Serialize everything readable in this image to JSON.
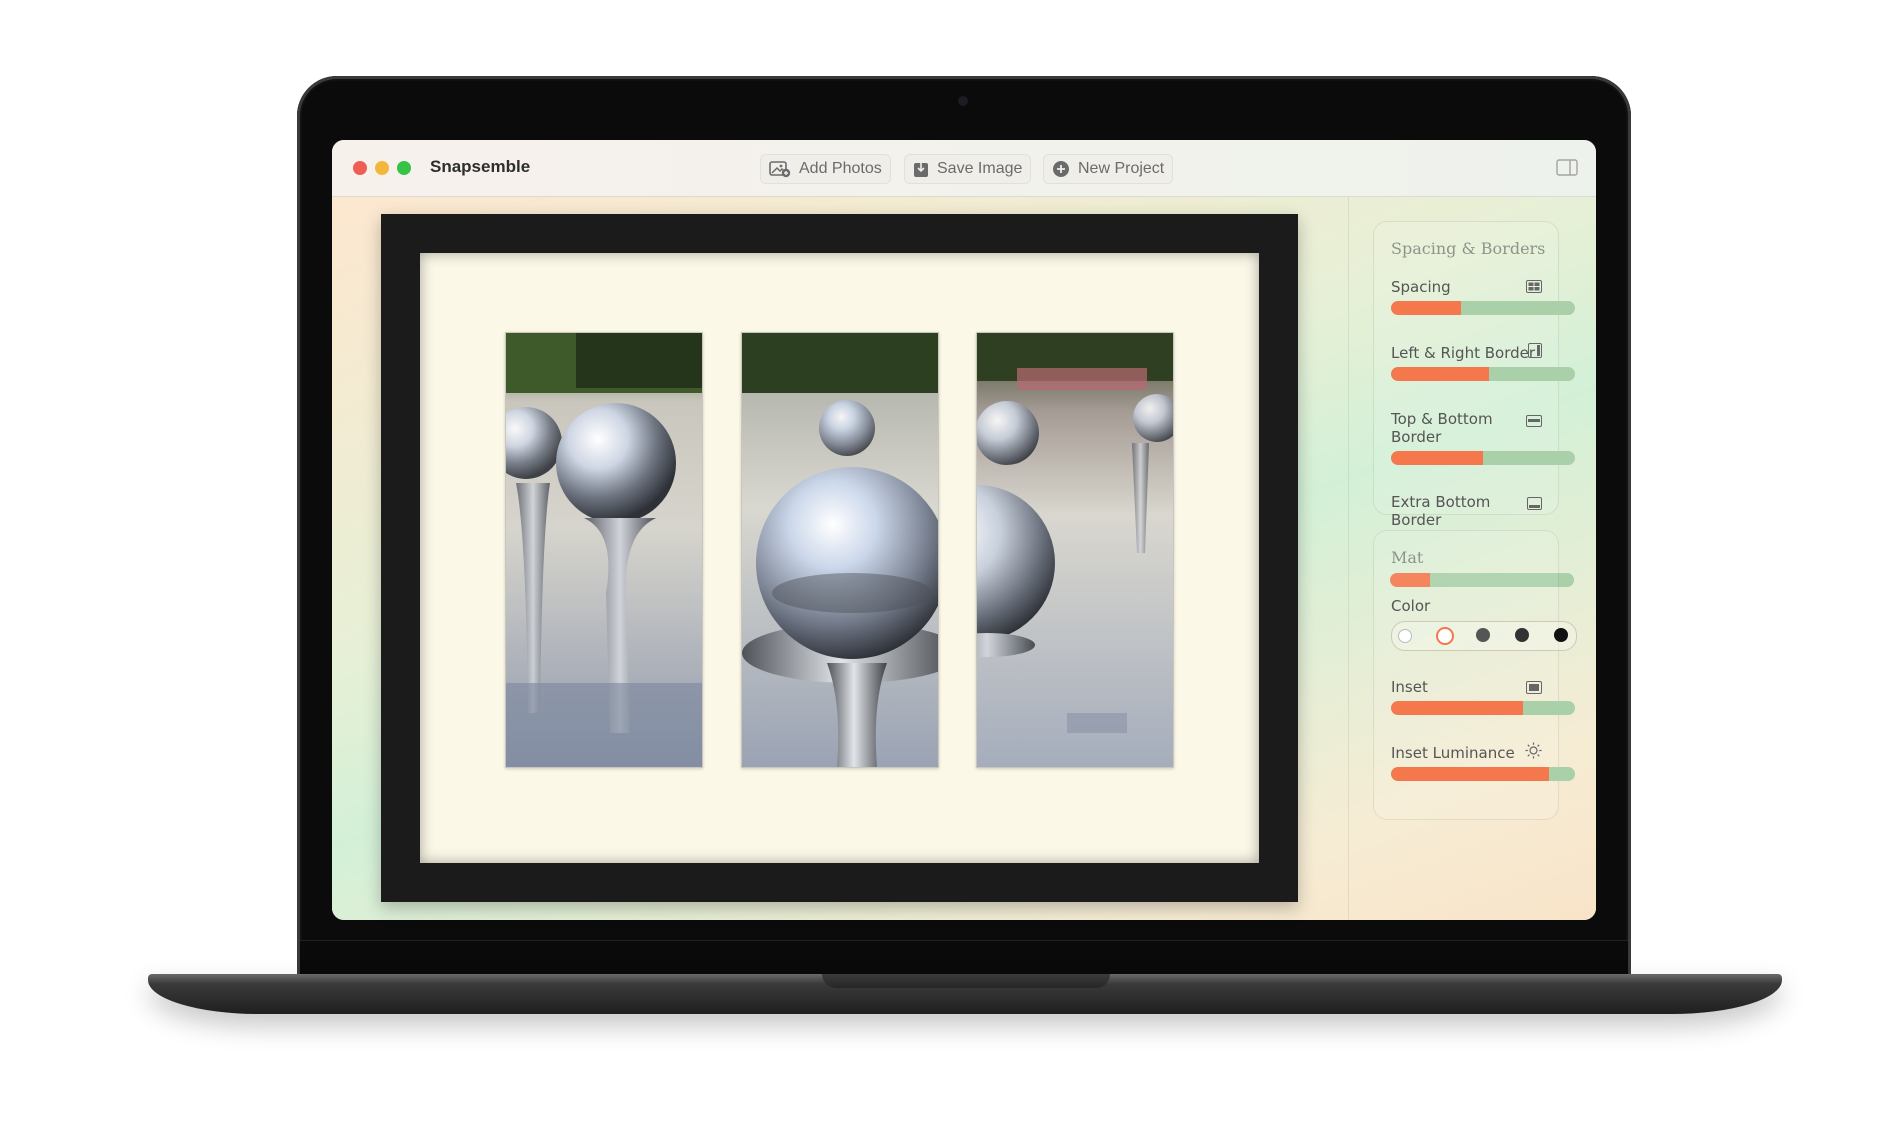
{
  "app": {
    "title": "Snapsemble"
  },
  "toolbar": {
    "add_photos": "Add Photos",
    "save_image": "Save Image",
    "new_project": "New Project"
  },
  "spacing_borders": {
    "title": "Spacing & Borders",
    "sliders": [
      {
        "label": "Spacing",
        "icon": "grid-icon",
        "value": 0.38
      },
      {
        "label": "Left & Right Border",
        "icon": "side-border-icon",
        "value": 0.53
      },
      {
        "label": "Top & Bottom Border",
        "icon": "top-border-icon",
        "value": 0.5
      },
      {
        "label": "Extra Bottom Border",
        "icon": "bottom-border-icon",
        "value": 0.22
      }
    ]
  },
  "mat": {
    "title": "Mat",
    "color_label": "Color",
    "colors": [
      "#ffffff",
      "#f4784b",
      "#555555",
      "#333333",
      "#111111"
    ],
    "selected_color_index": 1,
    "inset": {
      "label": "Inset",
      "icon": "inset-icon",
      "value": 0.72
    },
    "inset_luminance": {
      "label": "Inset Luminance",
      "icon": "sun-icon",
      "value": 0.86
    }
  },
  "theme": {
    "accent": "#f4784b",
    "track": "#a9d0a9"
  }
}
